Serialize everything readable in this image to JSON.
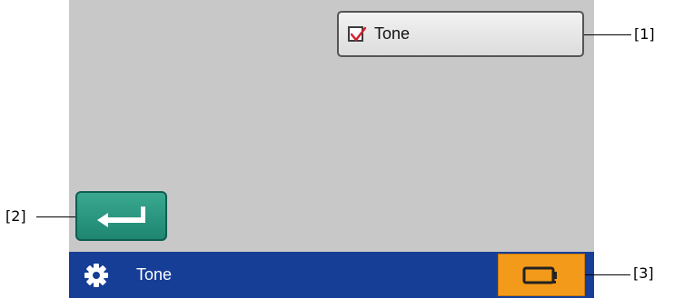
{
  "screen": {
    "tone_checkbox": {
      "label": "Tone",
      "checked": true,
      "check_color": "#d4202a"
    },
    "enter_button": {
      "icon": "enter-return-icon",
      "color": "#2a9680"
    },
    "status_bar": {
      "icon": "gear-icon",
      "title": "Tone",
      "background": "#163e96",
      "right_button": {
        "icon": "battery-icon",
        "color": "#f39a1a"
      }
    },
    "background": "#c8c8c8"
  },
  "callouts": [
    "[1]",
    "[2]",
    "[3]"
  ]
}
